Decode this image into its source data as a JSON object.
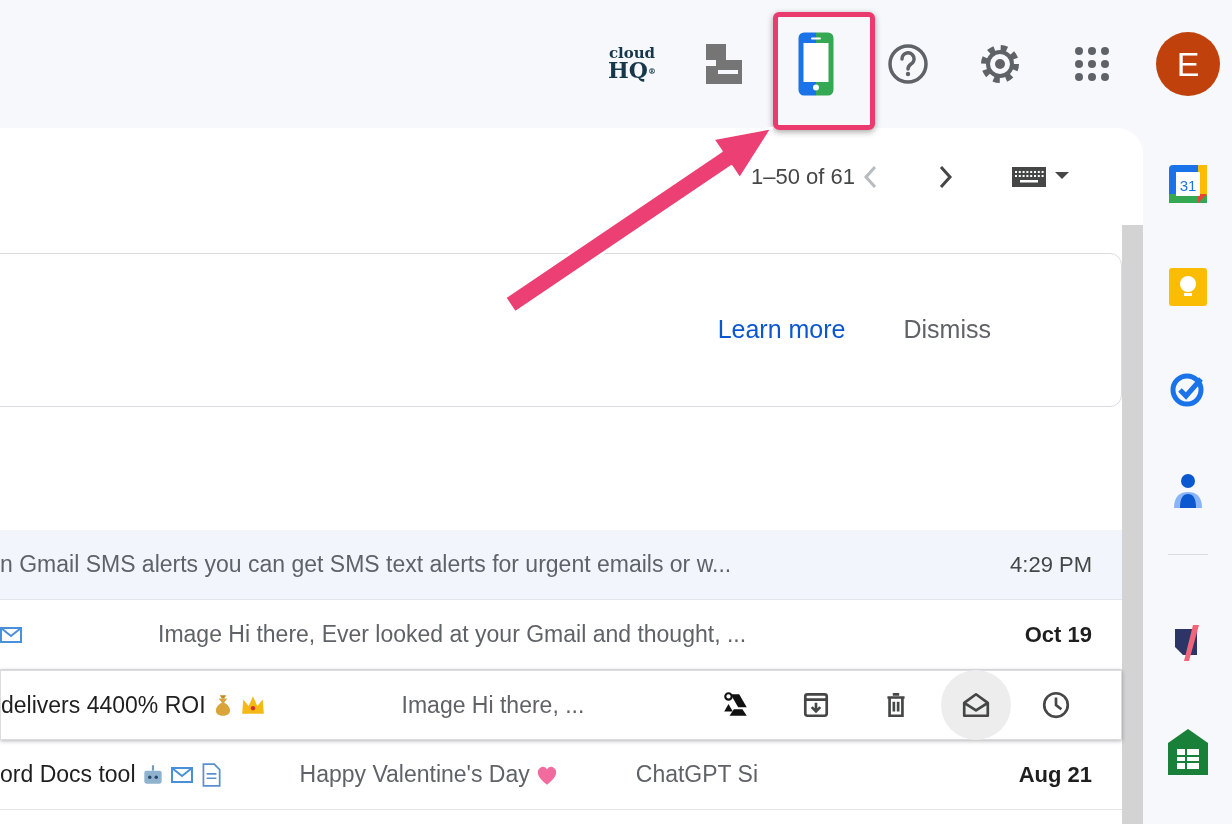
{
  "top_bar": {
    "logo": {
      "line1": "cloud",
      "line2": "HQ",
      "mark": "®"
    },
    "avatar": "E"
  },
  "toolbar": {
    "pagination": "1–50 of 61",
    "pager": [
      {
        "disabled": true
      },
      {
        "disabled": false
      }
    ]
  },
  "banner": {
    "learn_more": "Learn more",
    "dismiss": "Dismiss"
  },
  "emails": [
    {
      "snippet": "n Gmail SMS alerts you can get SMS text alerts for urgent emails or w...",
      "date": "4:29 PM",
      "unread": false,
      "hovered": false
    },
    {
      "snippet": "Image Hi there, Ever looked at your Gmail and thought, ...",
      "date": "Oct 19",
      "unread": true,
      "hovered": false
    },
    {
      "subject": "delivers 4400% ROI",
      "snippet": "Image Hi there, ...",
      "unread": false,
      "hovered": true
    },
    {
      "subject": "ord Docs tool",
      "snippet": "Happy Valentine's Day",
      "extra": "ChatGPT Si",
      "date": "Aug 21",
      "unread": true,
      "hovered": false
    }
  ],
  "side_panel": {
    "calendar_day": "31"
  }
}
